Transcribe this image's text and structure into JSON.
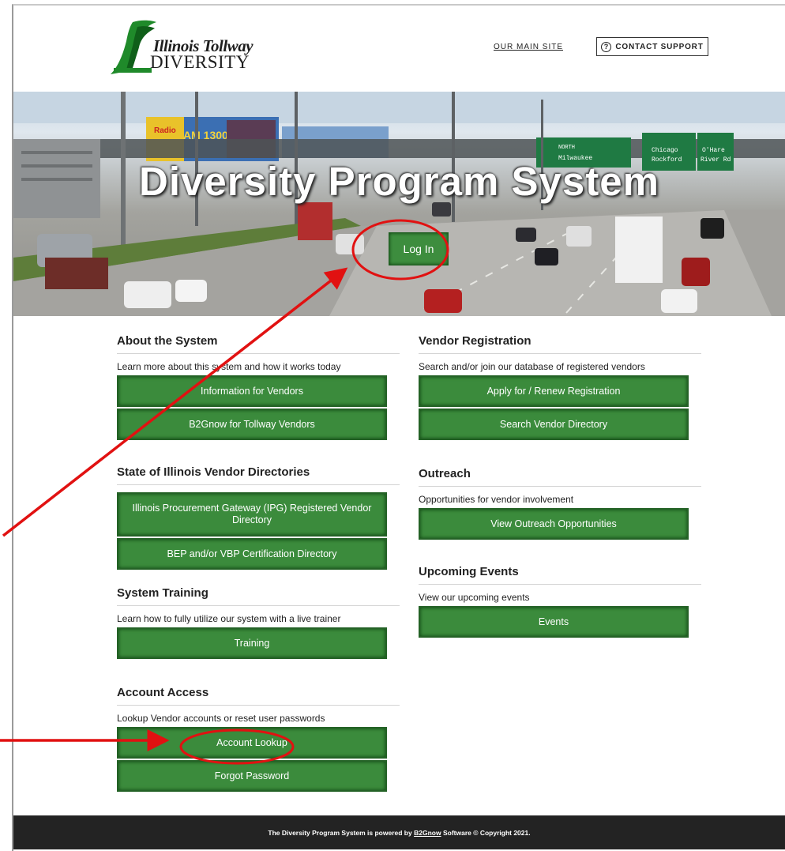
{
  "header": {
    "logo": {
      "line1": "Illinois Tollway",
      "line2": "DIVERSITY"
    },
    "main_site_link": "OUR MAIN SITE",
    "contact_support": "CONTACT SUPPORT",
    "contact_icon_glyph": "?"
  },
  "hero": {
    "title": "Diversity Program System",
    "login_button": "Log In",
    "billboard_text": "AM 1300",
    "billboard_brand": "Radio",
    "sign_text": [
      "NORTH",
      "Milwaukee",
      "Chicago",
      "Rockford",
      "O'Hare",
      "River Rd"
    ]
  },
  "sections": {
    "about": {
      "title": "About the System",
      "desc": "Learn more about this system and how it works today",
      "buttons": [
        "Information for Vendors",
        "B2Gnow for Tollway Vendors"
      ]
    },
    "state": {
      "title": "State of Illinois Vendor Directories",
      "buttons": [
        "Illinois Procurement Gateway (IPG) Registered Vendor Directory",
        "BEP and/or VBP Certification Directory"
      ]
    },
    "training": {
      "title": "System Training",
      "desc": "Learn how to fully utilize our system with a live trainer",
      "buttons": [
        "Training"
      ]
    },
    "account": {
      "title": "Account Access",
      "desc": "Lookup Vendor accounts or reset user passwords",
      "buttons": [
        "Account Lookup",
        "Forgot Password"
      ]
    },
    "vendor_reg": {
      "title": "Vendor Registration",
      "desc": "Search and/or join our database of registered vendors",
      "buttons": [
        "Apply for / Renew Registration",
        "Search Vendor Directory"
      ]
    },
    "outreach": {
      "title": "Outreach",
      "desc": "Opportunities for vendor involvement",
      "buttons": [
        "View Outreach Opportunities"
      ]
    },
    "events": {
      "title": "Upcoming Events",
      "desc": "View our upcoming events",
      "buttons": [
        "Events"
      ]
    }
  },
  "footer": {
    "prefix": "The Diversity Program System is powered by",
    "link": "B2Gnow",
    "suffix": "Software © Copyright 2021."
  },
  "colors": {
    "button_green": "#3b8b3c",
    "annotation_red": "#e11111",
    "footer_bg": "#232323"
  }
}
